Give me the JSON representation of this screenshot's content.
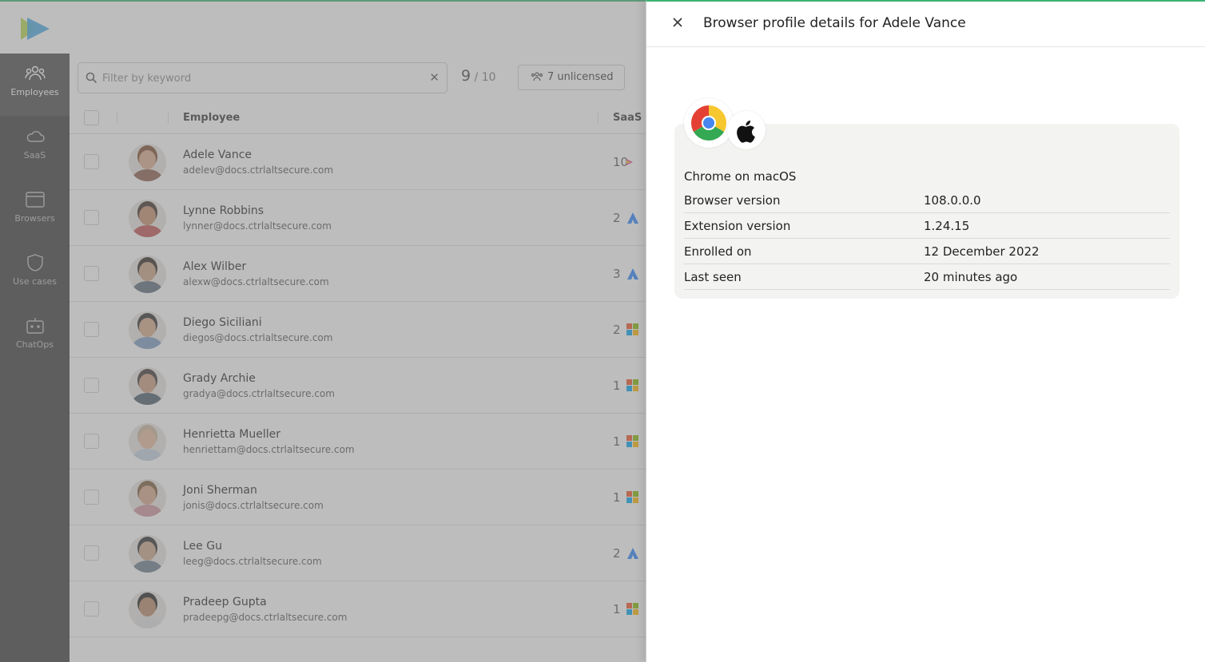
{
  "nav": [
    {
      "label": "Employees",
      "icon": "users-icon",
      "active": true
    },
    {
      "label": "SaaS",
      "icon": "cloud-icon"
    },
    {
      "label": "Browsers",
      "icon": "browser-window-icon"
    },
    {
      "label": "Use cases",
      "icon": "shield-icon"
    },
    {
      "label": "ChatOps",
      "icon": "chat-bot-icon"
    }
  ],
  "toolbar": {
    "filter_placeholder": "Filter by keyword",
    "count_main": "9",
    "count_sub": " / 10",
    "unlicensed_label": "7 unlicensed"
  },
  "table": {
    "columns": [
      "Employee",
      "SaaS"
    ],
    "rows": [
      {
        "name": "Adele Vance",
        "email": "adelev@docs.ctrlaltsecure.com",
        "saas_count": "10",
        "saas_icon": "multi-app-icon"
      },
      {
        "name": "Lynne Robbins",
        "email": "lynner@docs.ctrlaltsecure.com",
        "saas_count": "2",
        "saas_icon": "atlassian-icon"
      },
      {
        "name": "Alex Wilber",
        "email": "alexw@docs.ctrlaltsecure.com",
        "saas_count": "3",
        "saas_icon": "atlassian-icon"
      },
      {
        "name": "Diego Siciliani",
        "email": "diegos@docs.ctrlaltsecure.com",
        "saas_count": "2",
        "saas_icon": "microsoft-icon"
      },
      {
        "name": "Grady Archie",
        "email": "gradya@docs.ctrlaltsecure.com",
        "saas_count": "1",
        "saas_icon": "microsoft-icon"
      },
      {
        "name": "Henrietta Mueller",
        "email": "henriettam@docs.ctrlaltsecure.com",
        "saas_count": "1",
        "saas_icon": "microsoft-icon"
      },
      {
        "name": "Joni Sherman",
        "email": "jonis@docs.ctrlaltsecure.com",
        "saas_count": "1",
        "saas_icon": "microsoft-icon"
      },
      {
        "name": "Lee Gu",
        "email": "leeg@docs.ctrlaltsecure.com",
        "saas_count": "2",
        "saas_icon": "atlassian-icon"
      },
      {
        "name": "Pradeep Gupta",
        "email": "pradeepg@docs.ctrlaltsecure.com",
        "saas_count": "1",
        "saas_icon": "microsoft-icon"
      }
    ]
  },
  "drawer": {
    "title": "Browser profile details for Adele Vance",
    "profile": {
      "heading": "Chrome on macOS",
      "browser_icon": "chrome-icon",
      "os_icon": "apple-icon",
      "fields": [
        {
          "label": "Browser version",
          "value": "108.0.0.0"
        },
        {
          "label": "Extension version",
          "value": "1.24.15"
        },
        {
          "label": "Enrolled on",
          "value": "12 December 2022"
        },
        {
          "label": "Last seen",
          "value": "20 minutes ago"
        }
      ]
    }
  },
  "colors": {
    "accent_green": "#3cb371",
    "sidebar_bg": "#3a3a3a",
    "card_bg": "#f3f3f1"
  }
}
